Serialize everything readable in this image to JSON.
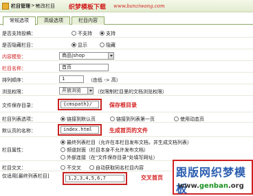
{
  "header": {
    "breadcrumb_root": "栏目管理",
    "separator": ">>",
    "breadcrumb_current": "修改栏目",
    "watermark": "织梦模板下载",
    "watermark_url": "www.banziwang.com"
  },
  "tabs": [
    {
      "label": "常规选项"
    },
    {
      "label": "高级选项"
    },
    {
      "label": "栏目内容"
    }
  ],
  "form": {
    "support_submit": {
      "label": "是否支持投稿：",
      "opt_no": "不支持",
      "opt_yes": "支持"
    },
    "hidden": {
      "label": "是否隐藏栏目：",
      "opt_show": "显示",
      "opt_hide": "隐藏"
    },
    "content_model": {
      "label": "内容模型：",
      "value": "商品|shop"
    },
    "column_name": {
      "label": "栏目名称：",
      "value": "首页"
    },
    "order": {
      "label": "排列顺序：",
      "value": "1",
      "hint": "（由低 -> 高）"
    },
    "access": {
      "label": "浏览权限：",
      "value": "开放浏览",
      "hint": "（仅限制栏目里的文档浏览权限）"
    },
    "save_dir": {
      "label": "文件保存目录：",
      "value": "{cmspath}/",
      "annotation": "保存根目录"
    },
    "list_option": {
      "label": "栏目列表选项：",
      "opt1": "链接到默认页",
      "opt2": "链接到列表第一页",
      "opt3": "使用动态页"
    },
    "default_page": {
      "label": "默认页的名称：",
      "value": "index.html",
      "annotation": "生成首页的文件"
    },
    "attribute": {
      "label": "栏目属性：",
      "opt1": "最终列表栏目（允许在本栏目发布文档，并生成文档列表）",
      "opt2": "频道封面（栏目本身不允许发布文档）",
      "opt3": "外部连接（在\"文件保存目录\"处填写网址）"
    },
    "cross": {
      "label": "栏目交叉：",
      "opt1": "不交叉",
      "opt2": "自动获取同名栏目内容"
    },
    "cross_ids": {
      "label": "仅适用[最终列表栏目]",
      "value": "1,2,3,4,5,6,7",
      "annotation": "交叉首页"
    }
  },
  "brand": {
    "name": "跟版网织梦模板",
    "url_prefix": "www.",
    "url_main": "genban",
    "url_suffix": ".org"
  }
}
